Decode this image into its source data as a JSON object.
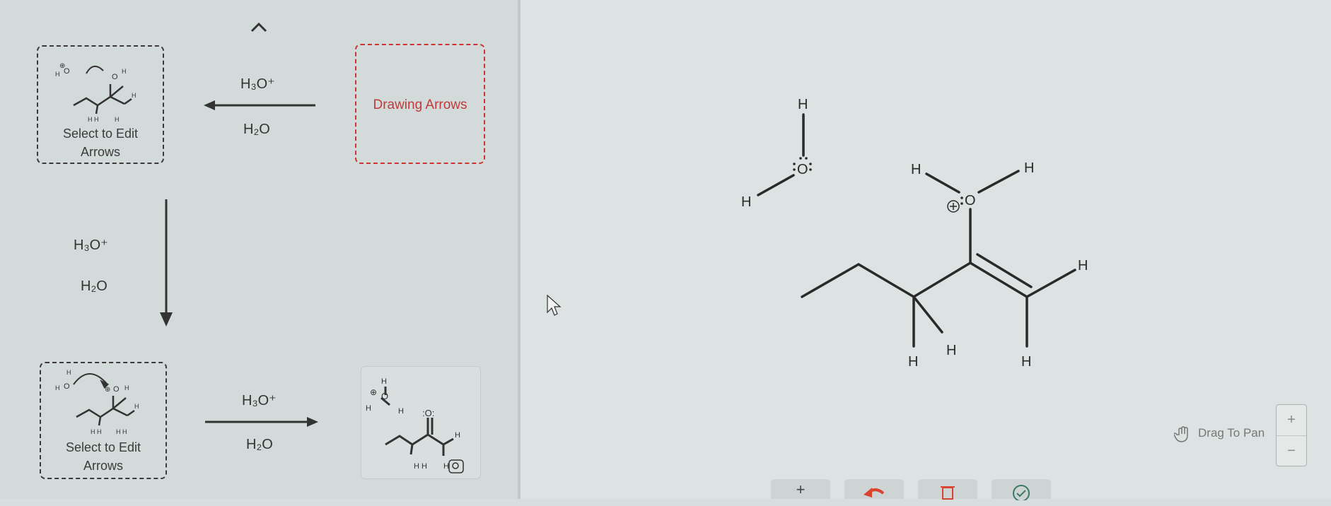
{
  "left_panel": {
    "card1": {
      "label_line1": "Select to Edit",
      "label_line2": "Arrows"
    },
    "card2": {
      "label": "Drawing Arrows"
    },
    "card3": {
      "label_line1": "Select to Edit",
      "label_line2": "Arrows"
    },
    "arrow_top": {
      "reagent_above": "H₃O⁺",
      "reagent_below": "H₂O"
    },
    "arrow_down": {
      "reagent_above": "H₃O⁺",
      "reagent_below": "H₂O"
    },
    "arrow_bottom": {
      "reagent_above": "H₃O⁺",
      "reagent_below": "H₂O"
    },
    "collapse_icon": "chevron-up-icon"
  },
  "canvas": {
    "water": {
      "h_top": "H",
      "o": "O",
      "h_left": "H"
    },
    "molecule": {
      "h_oxonium_left": "H",
      "h_oxonium_right": "H",
      "o_plus": "O",
      "h_vinyl": "H",
      "h_ch_1": "H",
      "h_ch_2": "H",
      "h_vinyl_bottom": "H"
    },
    "drag_to_pan": "Drag To Pan",
    "zoom_in": "+",
    "zoom_out": "−"
  },
  "toolbar": {
    "add": "+",
    "undo_icon": "undo-icon",
    "delete_icon": "trash-icon",
    "done_icon": "check-icon"
  },
  "colors": {
    "accent_red": "#cc3333",
    "undo_red": "#d9432f"
  }
}
